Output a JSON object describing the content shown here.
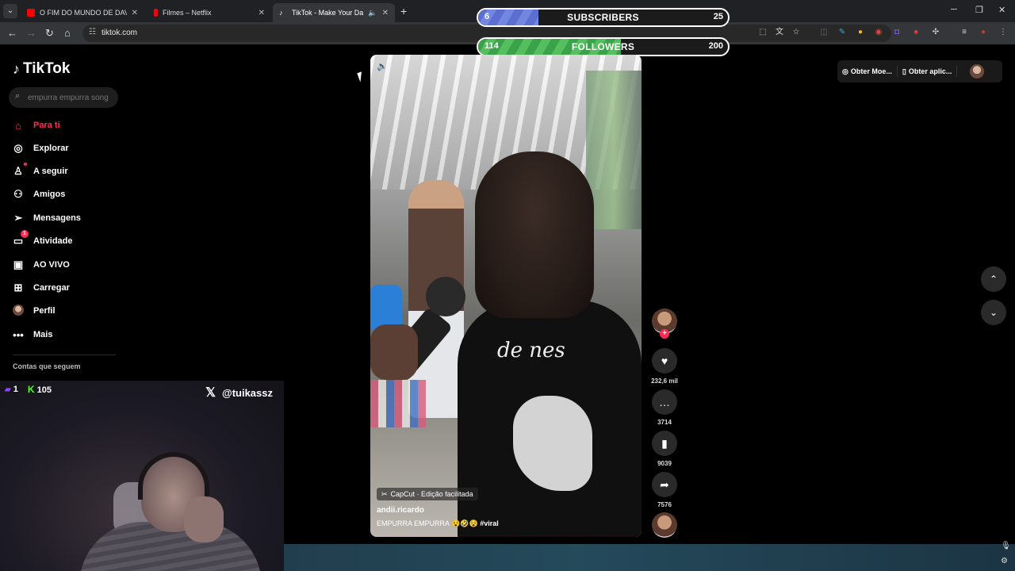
{
  "browser": {
    "tabs": [
      {
        "title": "O FIM DO MUNDO DE DAVID A",
        "favicon_color": "#ff0000"
      },
      {
        "title": "Filmes – Netflix",
        "favicon_color": "#e50914"
      },
      {
        "title": "TikTok - Make Your Day",
        "favicon_color": "#ffffff",
        "active": true
      }
    ],
    "url": "tiktok.com"
  },
  "overlay": {
    "subscribers": {
      "current": "6",
      "label": "SUBSCRIBERS",
      "goal": "25",
      "progress": 0.24
    },
    "followers": {
      "current": "114",
      "label": "FOLLOWERS",
      "goal": "200",
      "progress": 0.57
    }
  },
  "tiktok": {
    "logo": "TikTok",
    "search_placeholder": "empurra empurra song",
    "nav": [
      {
        "label": "Para ti",
        "icon": "home-icon"
      },
      {
        "label": "Explorar",
        "icon": "compass-icon"
      },
      {
        "label": "A seguir",
        "icon": "user-follow-icon"
      },
      {
        "label": "Amigos",
        "icon": "friends-icon"
      },
      {
        "label": "Mensagens",
        "icon": "send-icon"
      },
      {
        "label": "Atividade",
        "icon": "activity-icon",
        "badge": "1"
      },
      {
        "label": "AO VIVO",
        "icon": "live-icon"
      },
      {
        "label": "Carregar",
        "icon": "upload-icon"
      },
      {
        "label": "Perfil",
        "icon": "avatar"
      },
      {
        "label": "Mais",
        "icon": "more-icon"
      }
    ],
    "following_heading": "Contas que seguem",
    "top_right": {
      "coins": "Obter Moe...",
      "app": "Obter aplic..."
    },
    "video": {
      "capcut": "CapCut · Edição facilitada",
      "author": "andii.ricardo",
      "description": "EMPURRA EMPURRA",
      "hashtag": "#viral",
      "shirt_text": "de nes"
    },
    "actions": {
      "likes": "232,6 mil",
      "comments": "3714",
      "saves": "9039",
      "shares": "7576"
    }
  },
  "webcam": {
    "twitch_count": "1",
    "kick_count": "105",
    "handle": "@tuikassz"
  }
}
